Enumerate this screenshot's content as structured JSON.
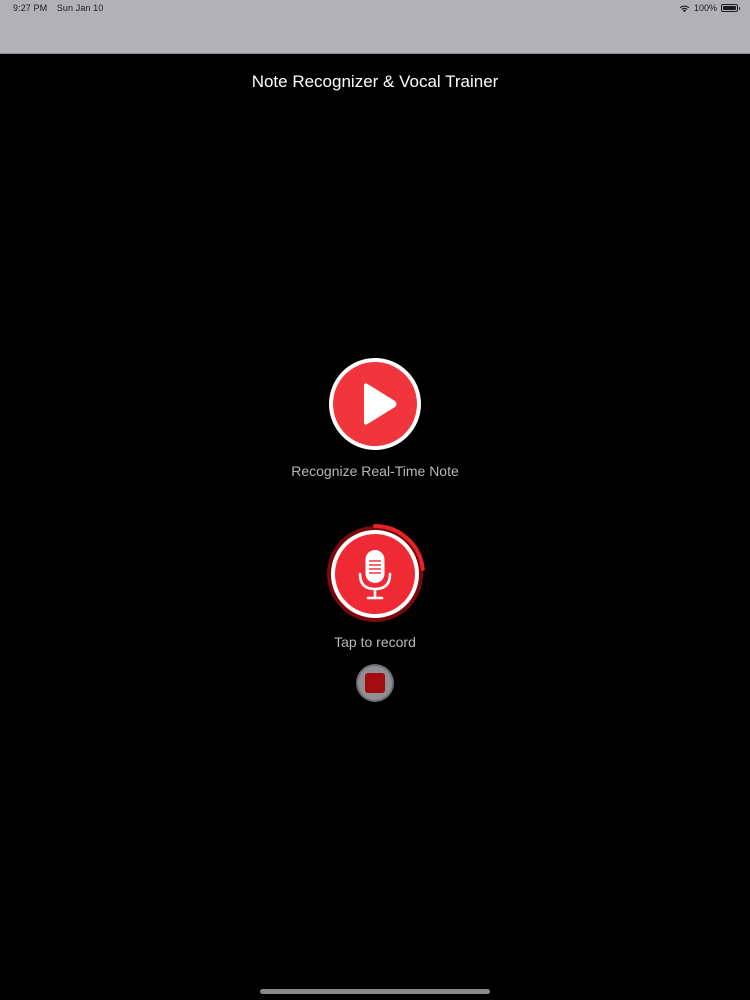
{
  "status_bar": {
    "time": "9:27 PM",
    "date": "Sun Jan 10",
    "battery": "100%",
    "icons": [
      "wifi-icon",
      "battery-icon"
    ]
  },
  "header": {
    "title": "Note Recognizer & Vocal Trainer"
  },
  "main": {
    "play": {
      "label": "Recognize Real-Time Note",
      "icon": "play-icon"
    },
    "record": {
      "label": "Tap to record",
      "icon": "microphone-icon"
    },
    "stop": {
      "icon": "stop-icon"
    }
  },
  "colors": {
    "accent_red": "#f0353d",
    "stop_red": "#a40d10",
    "background": "#000000",
    "status_bar": "#b2b1b5"
  }
}
